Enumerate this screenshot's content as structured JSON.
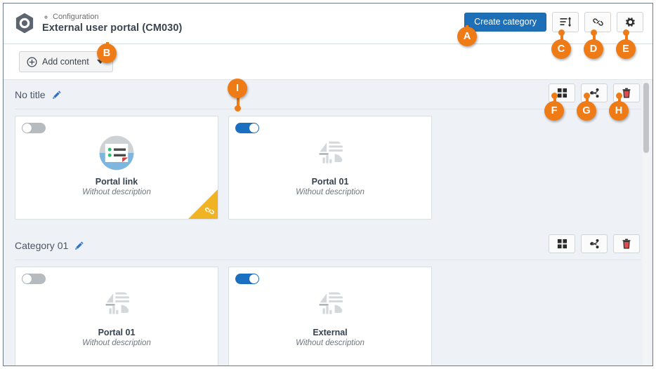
{
  "header": {
    "eyebrow": "Configuration",
    "eyebrow_icon": "gear-icon",
    "title": "External user portal (CM030)",
    "logo_icon": "hexagon-portal-logo-icon",
    "actions": {
      "create_category_label": "Create category",
      "sort_icon": "sort-list-icon",
      "link_icon": "link-icon",
      "settings_icon": "gear-icon"
    }
  },
  "toolbar": {
    "add_content_label": "Add content",
    "add_icon": "plus-circle-icon",
    "caret_icon": "chevron-down-icon"
  },
  "categories": [
    {
      "title": "No title",
      "edit_icon": "pencil-icon",
      "actions": {
        "layout_icon": "grid-icon",
        "share_icon": "share-icon",
        "delete_icon": "trash-icon"
      },
      "cards": [
        {
          "title": "Portal link",
          "description": "Without description",
          "enabled": false,
          "icon": "portal-link-thumbnail-icon",
          "ribbon": true,
          "ribbon_icon": "link-icon"
        },
        {
          "title": "Portal 01",
          "description": "Without description",
          "enabled": true,
          "icon": "portal-placeholder-thumbnail-icon",
          "ribbon": false,
          "ribbon_icon": ""
        }
      ]
    },
    {
      "title": "Category 01",
      "edit_icon": "pencil-icon",
      "actions": {
        "layout_icon": "grid-icon",
        "share_icon": "share-icon",
        "delete_icon": "trash-icon"
      },
      "cards": [
        {
          "title": "Portal 01",
          "description": "Without description",
          "enabled": false,
          "icon": "portal-placeholder-thumbnail-icon",
          "ribbon": false,
          "ribbon_icon": ""
        },
        {
          "title": "External",
          "description": "Without description",
          "enabled": true,
          "icon": "portal-placeholder-thumbnail-icon",
          "ribbon": false,
          "ribbon_icon": ""
        }
      ]
    }
  ],
  "annotations": [
    {
      "label": "A",
      "target": "create-category-button"
    },
    {
      "label": "B",
      "target": "add-content-button"
    },
    {
      "label": "C",
      "target": "sort-button"
    },
    {
      "label": "D",
      "target": "link-button"
    },
    {
      "label": "E",
      "target": "settings-button"
    },
    {
      "label": "F",
      "target": "category-layout-button"
    },
    {
      "label": "G",
      "target": "category-share-button"
    },
    {
      "label": "H",
      "target": "category-delete-button"
    },
    {
      "label": "I",
      "target": "card-enable-toggle"
    }
  ],
  "colors": {
    "accent_orange": "#ee7b16",
    "primary_blue": "#1d70b8",
    "toggle_on": "#1b6fc0",
    "ribbon_yellow": "#f0b323",
    "canvas": "#eef2f7"
  },
  "scrollbar": {
    "orientation": "vertical"
  }
}
